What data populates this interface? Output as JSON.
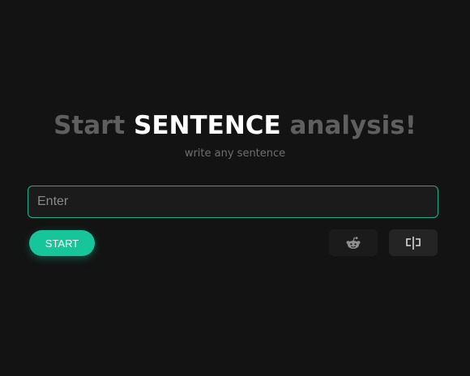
{
  "hero": {
    "title_prefix": "Start",
    "title_highlight": "SENTENCE",
    "title_suffix": "analysis!",
    "subtitle": "write any sentence"
  },
  "input": {
    "placeholder": "Enter",
    "value": ""
  },
  "actions": {
    "start_label": "START",
    "reddit_icon": "reddit-icon",
    "split_icon": "split-view-icon"
  },
  "colors": {
    "accent": "#17c59a",
    "background": "#131313",
    "input_border": "#1fae8a",
    "muted_text": "#5f5f5f"
  }
}
